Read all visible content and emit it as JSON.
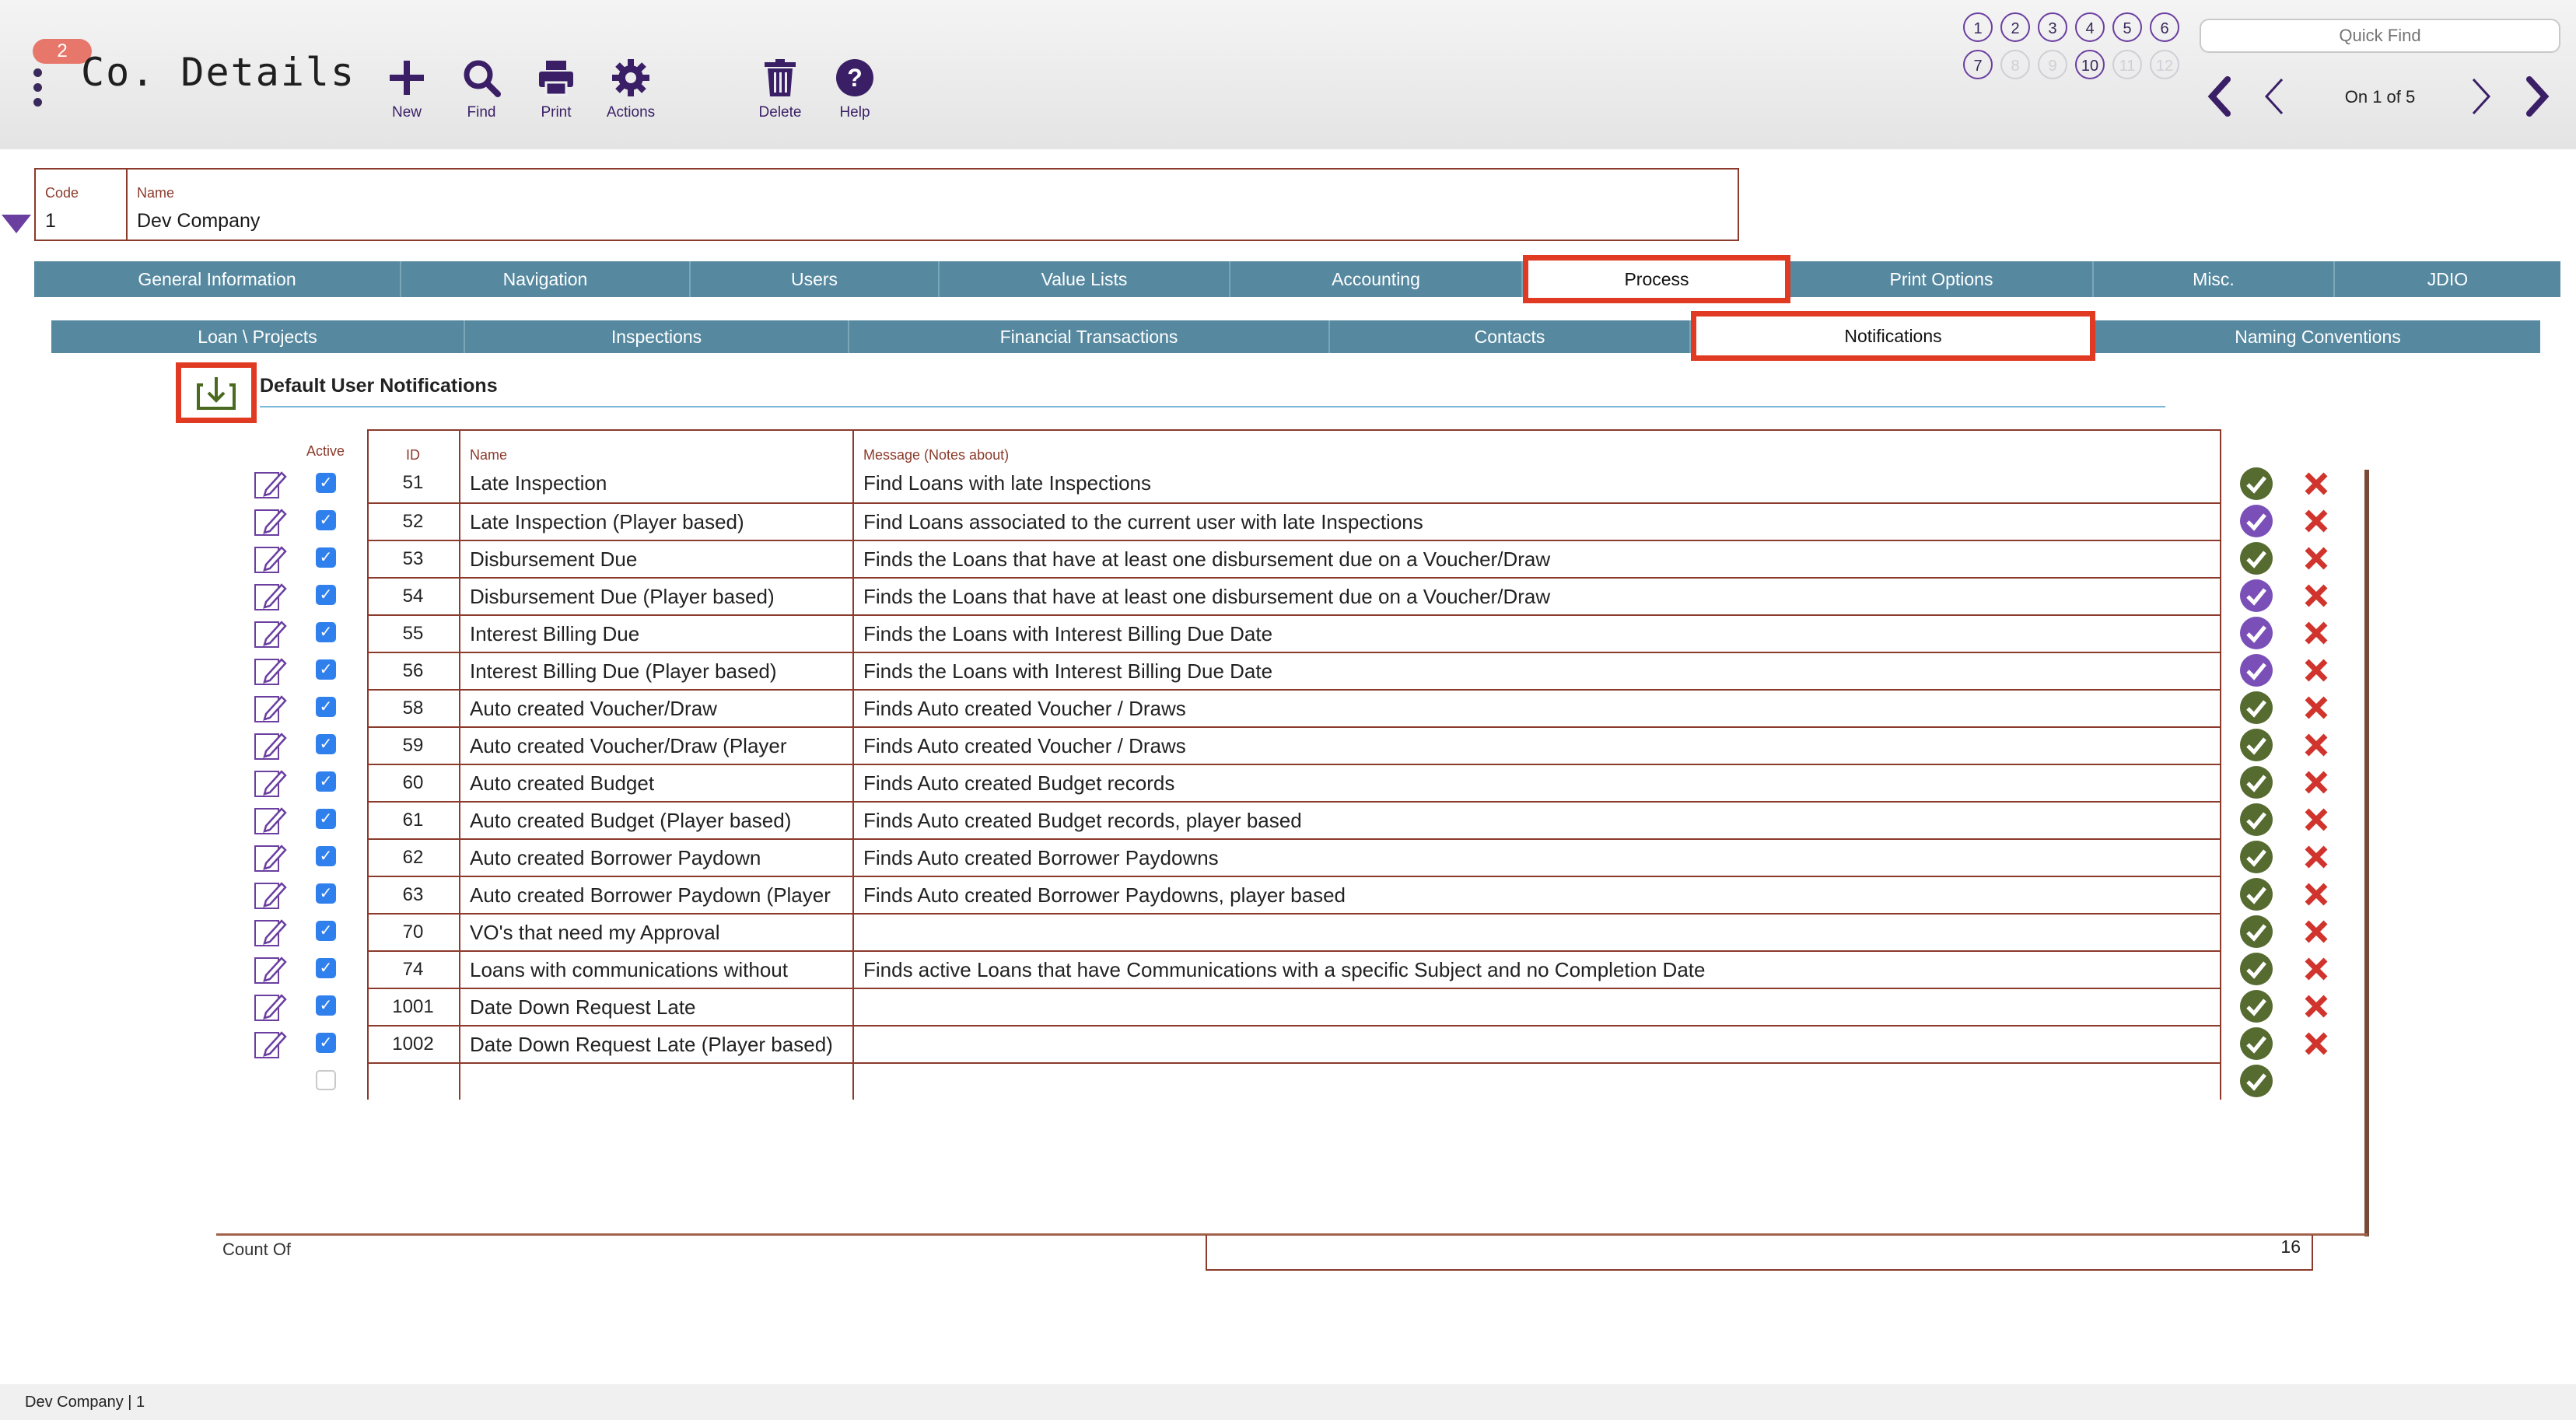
{
  "header": {
    "badge": "2",
    "title": "Co. Details",
    "tools": {
      "new": "New",
      "find": "Find",
      "print": "Print",
      "actions": "Actions",
      "delete": "Delete",
      "help": "Help"
    },
    "circle_buttons_row1": [
      "1",
      "2",
      "3",
      "4",
      "5",
      "6"
    ],
    "circle_buttons_row2": [
      "7",
      "8",
      "9",
      "10",
      "11",
      "12"
    ],
    "quick_find_placeholder": "Quick Find",
    "record_info": "On 1 of 5"
  },
  "record": {
    "code_label": "Code",
    "code_value": "1",
    "name_label": "Name",
    "name_value": "Dev Company"
  },
  "main_tabs": [
    "General Information",
    "Navigation",
    "Users",
    "Value Lists",
    "Accounting",
    "Process",
    "Print Options",
    "Misc.",
    "JDIO"
  ],
  "main_tab_active": "Process",
  "sub_tabs": [
    "Loan \\ Projects",
    "Inspections",
    "Financial Transactions",
    "Contacts",
    "Notifications",
    "Naming Conventions"
  ],
  "sub_tab_active": "Notifications",
  "section": {
    "title": "Default User Notifications"
  },
  "table": {
    "active_header": "Active",
    "headers": {
      "id": "ID",
      "name": "Name",
      "message": "Message (Notes about)"
    },
    "rows": [
      {
        "id": "51",
        "name": "Late Inspection",
        "message": "Find Loans with late Inspections",
        "status": "green"
      },
      {
        "id": "52",
        "name": "Late Inspection (Player based)",
        "message": "Find Loans associated to the current user with late Inspections",
        "status": "purple"
      },
      {
        "id": "53",
        "name": "Disbursement Due",
        "message": "Finds the Loans that have at least one disbursement due on a Voucher/Draw",
        "status": "green"
      },
      {
        "id": "54",
        "name": "Disbursement Due (Player based)",
        "message": "Finds the Loans that have at least one disbursement due on a Voucher/Draw",
        "status": "purple"
      },
      {
        "id": "55",
        "name": "Interest Billing Due",
        "message": "Finds the Loans with Interest Billing Due Date",
        "status": "purple"
      },
      {
        "id": "56",
        "name": "Interest Billing Due (Player based)",
        "message": "Finds the Loans with Interest Billing Due Date",
        "status": "purple"
      },
      {
        "id": "58",
        "name": "Auto created Voucher/Draw",
        "message": "Finds Auto created Voucher / Draws",
        "status": "green"
      },
      {
        "id": "59",
        "name": "Auto created Voucher/Draw (Player",
        "message": "Finds Auto created Voucher / Draws",
        "status": "green"
      },
      {
        "id": "60",
        "name": "Auto created Budget",
        "message": "Finds Auto created Budget records",
        "status": "green"
      },
      {
        "id": "61",
        "name": "Auto created Budget (Player based)",
        "message": "Finds Auto created Budget records, player based",
        "status": "green"
      },
      {
        "id": "62",
        "name": "Auto created Borrower Paydown",
        "message": "Finds Auto created Borrower Paydowns",
        "status": "green"
      },
      {
        "id": "63",
        "name": "Auto created Borrower Paydown (Player",
        "message": "Finds Auto created Borrower Paydowns, player based",
        "status": "green"
      },
      {
        "id": "70",
        "name": "VO's that need my Approval",
        "message": "",
        "status": "green"
      },
      {
        "id": "74",
        "name": "Loans with communications without",
        "message": "Finds active Loans that have Communications with a specific Subject and no Completion Date",
        "status": "green"
      },
      {
        "id": "1001",
        "name": "Date Down Request Late",
        "message": "",
        "status": "green"
      },
      {
        "id": "1002",
        "name": "Date Down Request Late (Player based)",
        "message": "",
        "status": "green"
      }
    ],
    "count_label": "Count Of",
    "count_value": "16"
  },
  "colors": {
    "tab_bg": "#5689a0",
    "highlight": "#e03a22",
    "grid_border": "#8b3a2b",
    "ok_green": "#556b2f",
    "ok_purple": "#7b4fb8",
    "delete_red": "#d0342c",
    "checkbox_blue": "#2f80ed"
  },
  "icons": {
    "edit": "pencil-edit-icon",
    "ok": "checkmark-circle-icon",
    "delete": "x-delete-icon",
    "export": "download-tray-icon"
  },
  "footer": {
    "text": "Dev Company | 1"
  }
}
